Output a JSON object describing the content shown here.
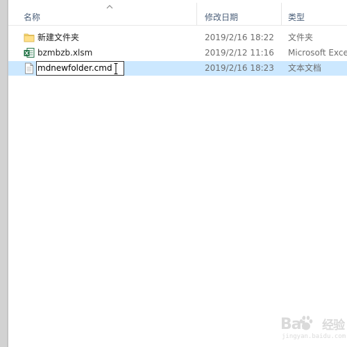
{
  "columns": {
    "name": "名称",
    "date": "修改日期",
    "type": "类型"
  },
  "files": [
    {
      "icon": "folder-icon",
      "name": "新建文件夹",
      "date": "2019/2/16 18:22",
      "type": "文件夹",
      "selected": false
    },
    {
      "icon": "excel-icon",
      "name": "bzmbzb.xlsm",
      "date": "2019/2/12 11:16",
      "type": "Microsoft Excel",
      "selected": false
    },
    {
      "icon": "text-document-icon",
      "name": "mdnewfolder.cmd",
      "date": "2019/2/16 18:23",
      "type": "文本文档",
      "selected": true
    }
  ],
  "rename": {
    "value": "mdnewfolder.cmd"
  },
  "watermark": {
    "text": "Bai",
    "suffix": "经验",
    "site": "jingyan.baidu.com"
  },
  "colors": {
    "selection": "#cce8ff",
    "header_text": "#4c607a",
    "nav_strip": "#d2d2d2"
  }
}
